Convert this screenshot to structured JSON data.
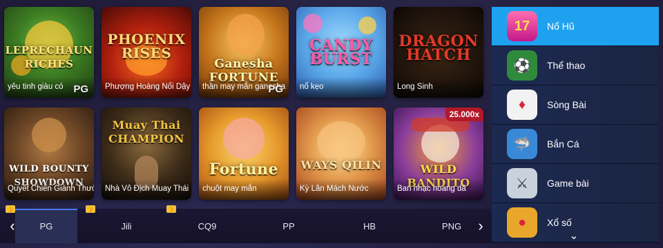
{
  "games": [
    {
      "logo": "LEPRECHAUN RICHES",
      "caption": "yêu tinh giàu có",
      "tag": "PG"
    },
    {
      "logo": "PHOENIX RISES",
      "caption": "Phượng Hoàng Nổi Dậy",
      "tag": ""
    },
    {
      "logo": "Ganesha FORTUNE",
      "caption": "thần may mắn ganesha",
      "tag": "PG"
    },
    {
      "logo": "CANDY BURST",
      "caption": "nổ kẹo",
      "tag": ""
    },
    {
      "logo": "DRAGON HATCH",
      "caption": "Long Sinh",
      "tag": ""
    },
    {
      "logo": "WILD BOUNTY SHOWDOWN",
      "caption": "Quyết Chiến Giành Thưởng",
      "tag": ""
    },
    {
      "logo": "Muay Thai CHAMPION",
      "caption": "Nhà Vô Địch Muay Thái",
      "tag": ""
    },
    {
      "logo": "Fortune",
      "caption": "chuột may mắn",
      "tag": ""
    },
    {
      "logo": "WAYS QILIN",
      "caption": "Kỳ Lân Mách Nước",
      "tag": ""
    },
    {
      "logo": "WILD BANDITO",
      "caption": "Ban nhạc hoang dã",
      "tag": "",
      "badge": "25.000x"
    }
  ],
  "providers": {
    "prev": "‹",
    "next": "›",
    "tabs": [
      "PG",
      "Jili",
      "CQ9",
      "PP",
      "HB",
      "PNG"
    ]
  },
  "sidebar": {
    "items": [
      {
        "label": "Nổ Hũ",
        "icon": "slot-777-icon",
        "glyph": "17"
      },
      {
        "label": "Thể thao",
        "icon": "soccer-ball-icon",
        "glyph": "⚽"
      },
      {
        "label": "Sòng Bài",
        "icon": "casino-chips-icon",
        "glyph": "♦"
      },
      {
        "label": "Bắn Cá",
        "icon": "shark-fish-icon",
        "glyph": "🦈"
      },
      {
        "label": "Game bài",
        "icon": "crossed-swords-icon",
        "glyph": "⚔"
      },
      {
        "label": "Xổ số",
        "icon": "lottery-balls-icon",
        "glyph": "●"
      }
    ],
    "down": "⌄"
  }
}
